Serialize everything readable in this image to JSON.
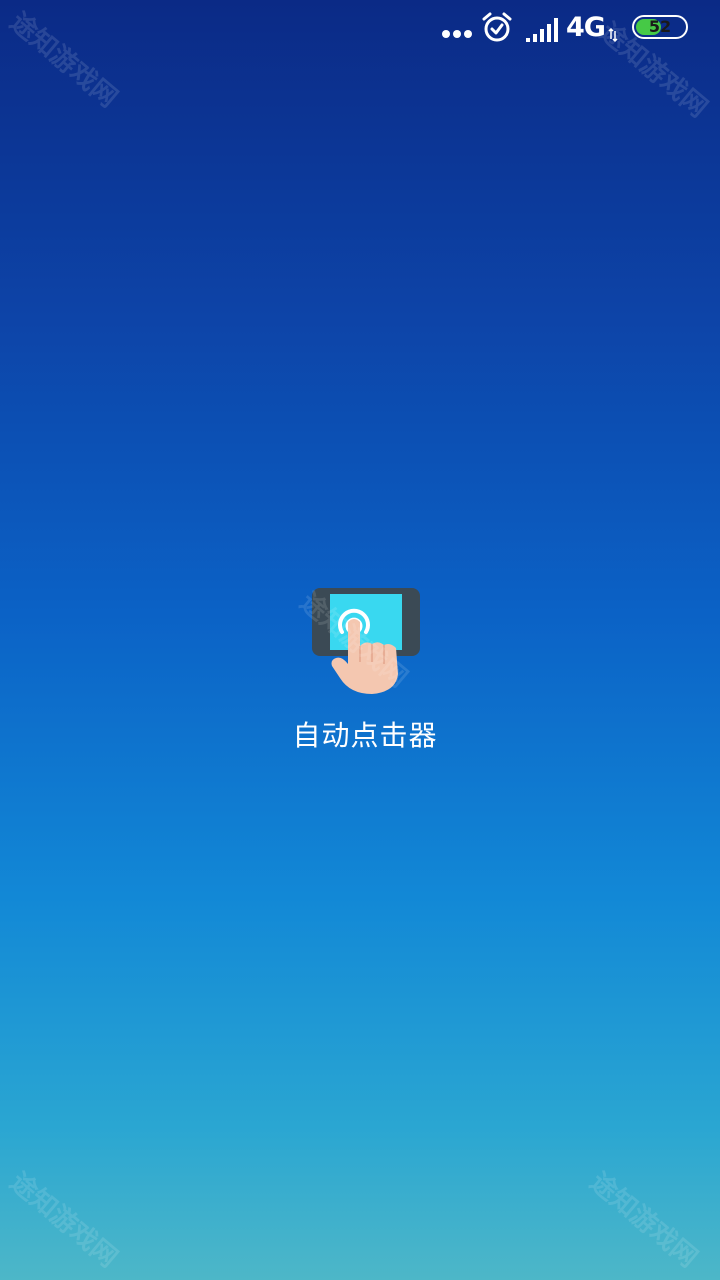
{
  "status_bar": {
    "network_type": "4G",
    "battery_level": "52",
    "battery_fraction": 0.52,
    "icons": [
      "more-dots-icon",
      "alarm-icon",
      "signal-strength-icon",
      "data-activity-icon",
      "battery-icon"
    ],
    "battery_color": "#46c946"
  },
  "app": {
    "name": "自动点击器",
    "icon": "auto-clicker-app-icon"
  },
  "watermark": {
    "text": "途知游戏网"
  },
  "colors": {
    "background_top": "#0b2a86",
    "background_bottom": "#4db7c8",
    "icon_screen": "#39d8f0",
    "icon_frame": "#3b4a55",
    "hand": "#f4c7b0"
  }
}
